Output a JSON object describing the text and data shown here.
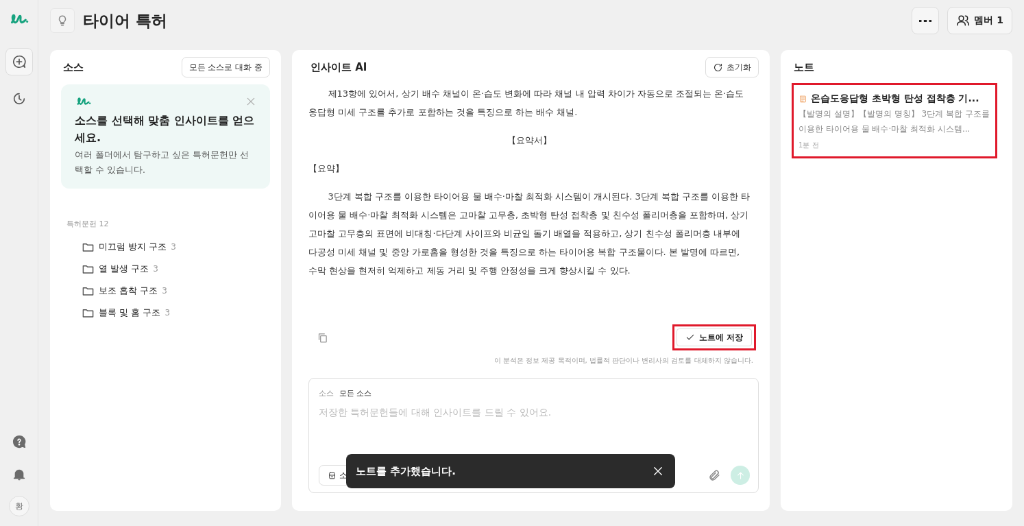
{
  "header": {
    "title": "타이어 특허",
    "members_button": "멤버 1"
  },
  "rail": {
    "avatar": "황"
  },
  "sources": {
    "title": "소스",
    "scope_button": "모든 소스로 대화 중",
    "tip": {
      "title": "소스를 선택해 맞춤 인사이트를 얻으세요.",
      "text": "여러 폴더에서 탐구하고 싶은 특허문헌만 선택할 수 있습니다."
    },
    "group_label": "특허문헌 12",
    "folders": [
      {
        "name": "미끄럼 방지 구조",
        "count": "3"
      },
      {
        "name": "열 발생 구조",
        "count": "3"
      },
      {
        "name": "보조 흡착 구조",
        "count": "3"
      },
      {
        "name": "블록 및 홈 구조",
        "count": "3"
      }
    ]
  },
  "chat": {
    "title": "인사이트 AI",
    "reset_button": "초기화",
    "paragraphs": [
      {
        "kind": "indent",
        "text": "제13항에 있어서, 상기 배수 채널이 온·습도 변화에 따라 채널 내 압력 차이가 자동으로 조절되는 온·습도 응답형 미세 구조를 추가로 포함하는 것을 특징으로 하는 배수 채널."
      },
      {
        "kind": "center",
        "text": "【요약서】"
      },
      {
        "kind": "plain",
        "text": "【요약】"
      },
      {
        "kind": "indent",
        "text": "3단계 복합 구조를 이용한 타이어용 물 배수·마찰 최적화 시스템이 개시된다. 3단계 복합 구조를 이용한 타이어용 물 배수·마찰 최적화 시스템은 고마찰 고무층, 초박형 탄성 접착층 및 친수성 폴리머층을 포함하며, 상기 고마찰 고무층의 표면에 비대칭·다단계 사이프와 비균일 돌기 배열을 적용하고, 상기 친수성 폴리머층 내부에 다공성 미세 채널 및 중앙 가로홈을 형성한 것을 특징으로 하는 타이어용 복합 구조물이다. 본 발명에 따르면, 수막 현상을 현저히 억제하고 제동 거리 및 주행 안정성을 크게 향상시킬 수 있다."
      }
    ],
    "save_button": {
      "label": "노트에 저장",
      "highlighted": true
    },
    "disclaimer": "이 분석은 정보 제공 목적이며, 법률적 판단이나 변리사의 검토를 대체하지 않습니다.",
    "composer": {
      "source_label": "소스",
      "source_value": "모든 소스",
      "placeholder": "저장한 특허문헌들에 대해 인사이트를 드릴 수 있어요.",
      "source_chip": "소"
    }
  },
  "notes": {
    "title": "노트",
    "items": [
      {
        "title": "온습도응답형 초박형 탄성 접착층 기...",
        "preview": "【발명의 설명】【발명의 명칭】 3단계 복합 구조를 이용한 타이어용 물 배수·마찰 최적화 시스템...",
        "time": "1분 전",
        "highlighted": true
      }
    ]
  },
  "toast": {
    "message": "노트를 추가했습니다."
  }
}
